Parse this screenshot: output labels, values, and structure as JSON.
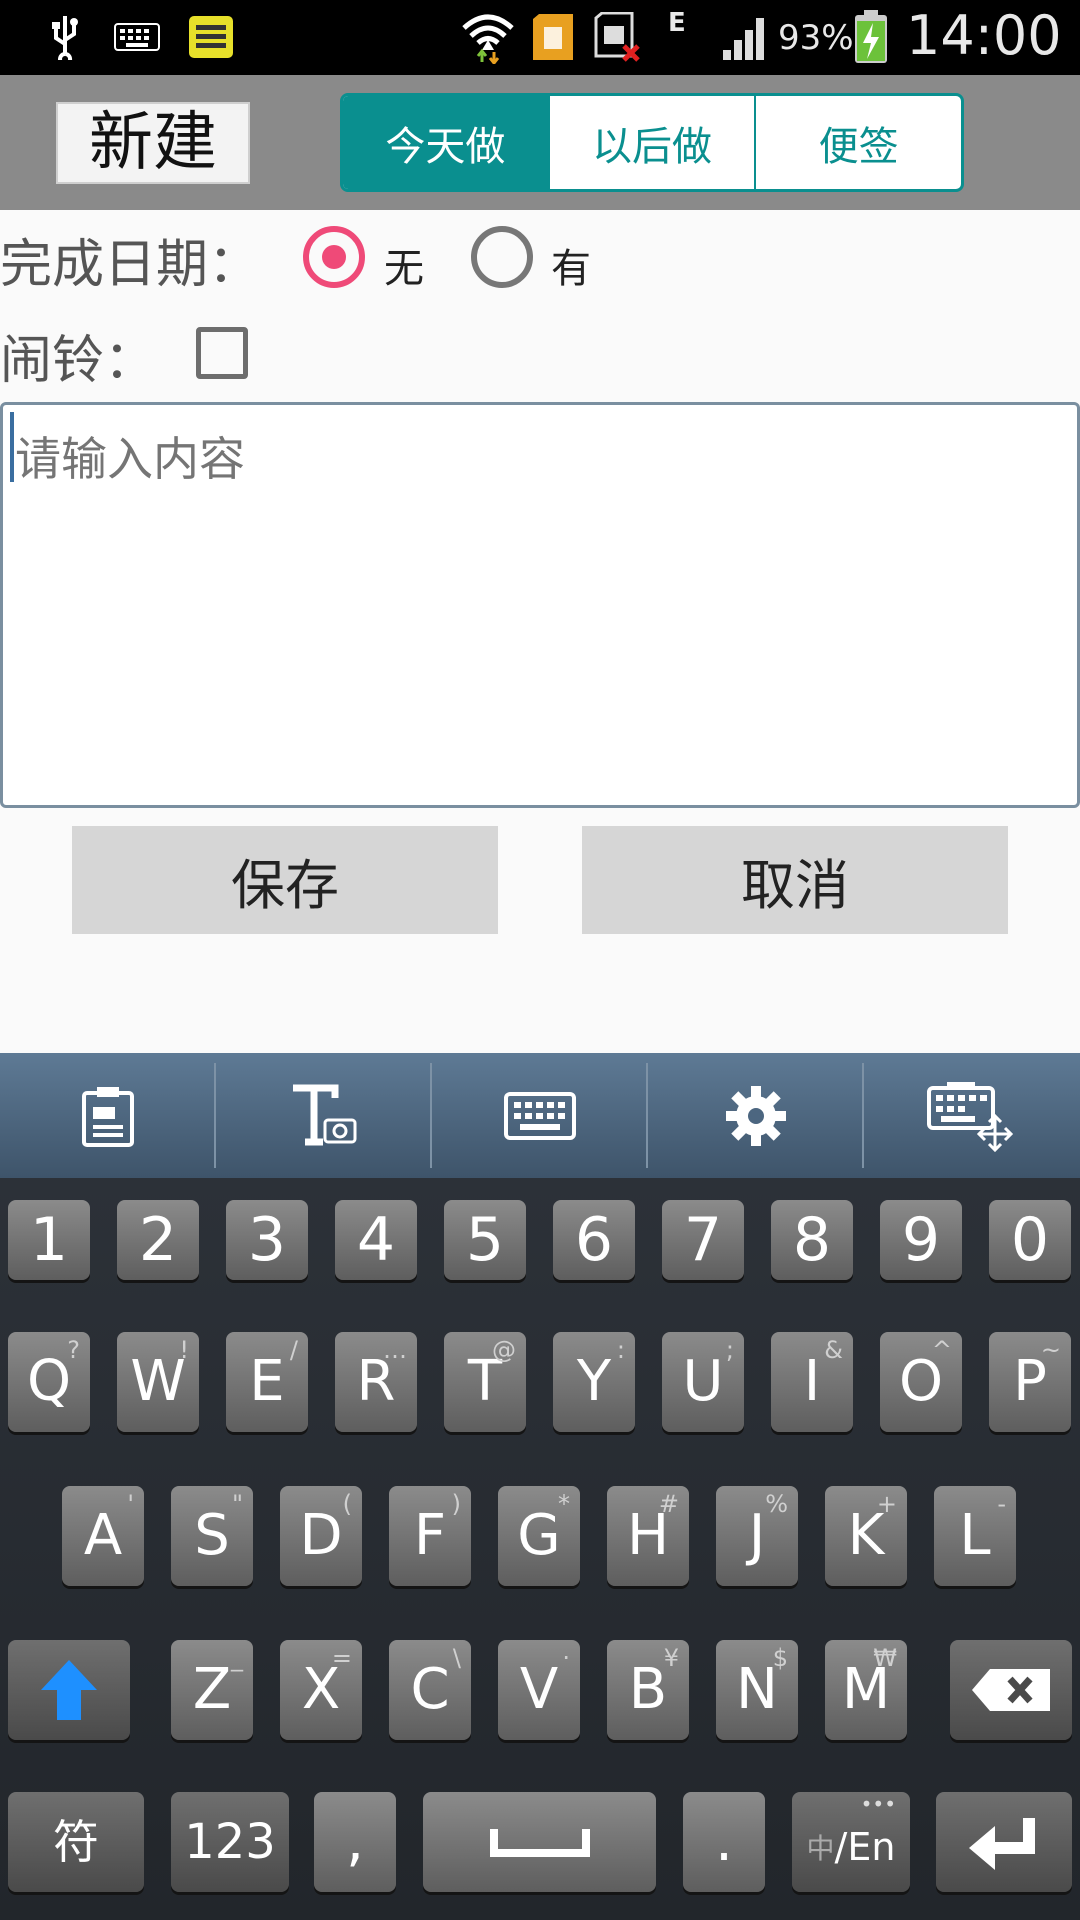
{
  "status_bar": {
    "battery": "93%",
    "time": "14:00",
    "network": "E",
    "icons": [
      "usb-icon",
      "keyboard-icon",
      "notes-app-icon",
      "wifi-icon",
      "sim-card-icon",
      "sd-card-error-icon",
      "signal-icon",
      "battery-charging-icon"
    ]
  },
  "header": {
    "new_label": "新建",
    "tabs": [
      {
        "label": "今天做",
        "active": true
      },
      {
        "label": "以后做",
        "active": false
      },
      {
        "label": "便签",
        "active": false
      }
    ]
  },
  "form": {
    "due_date_label": "完成日期：",
    "due_none": "无",
    "due_has": "有",
    "due_selected": "无",
    "alarm_label": "闹铃：",
    "alarm_checked": false,
    "content_placeholder": "请输入内容",
    "content_value": "",
    "save_label": "保存",
    "cancel_label": "取消"
  },
  "keyboard": {
    "toolbar": [
      "clipboard-icon",
      "handwriting-text-icon",
      "keyboard-icon",
      "settings-gear-icon",
      "keyboard-move-icon"
    ],
    "row_numbers": [
      "1",
      "2",
      "3",
      "4",
      "5",
      "6",
      "7",
      "8",
      "9",
      "0"
    ],
    "row1": [
      {
        "key": "Q",
        "sub": "?"
      },
      {
        "key": "W",
        "sub": "!"
      },
      {
        "key": "E",
        "sub": "/"
      },
      {
        "key": "R",
        "sub": "…"
      },
      {
        "key": "T",
        "sub": "@"
      },
      {
        "key": "Y",
        "sub": ":"
      },
      {
        "key": "U",
        "sub": ";"
      },
      {
        "key": "I",
        "sub": "&"
      },
      {
        "key": "O",
        "sub": "^"
      },
      {
        "key": "P",
        "sub": "~"
      }
    ],
    "row2": [
      {
        "key": "A",
        "sub": "'"
      },
      {
        "key": "S",
        "sub": "\""
      },
      {
        "key": "D",
        "sub": "("
      },
      {
        "key": "F",
        "sub": ")"
      },
      {
        "key": "G",
        "sub": "*"
      },
      {
        "key": "H",
        "sub": "#"
      },
      {
        "key": "J",
        "sub": "%"
      },
      {
        "key": "K",
        "sub": "+"
      },
      {
        "key": "L",
        "sub": "-"
      }
    ],
    "row3": [
      {
        "key": "Z",
        "sub": "_"
      },
      {
        "key": "X",
        "sub": "="
      },
      {
        "key": "C",
        "sub": "\\"
      },
      {
        "key": "V",
        "sub": "·"
      },
      {
        "key": "B",
        "sub": "¥"
      },
      {
        "key": "N",
        "sub": "$"
      },
      {
        "key": "M",
        "sub": "₩"
      }
    ],
    "symbol_key": "符",
    "num_key": "123",
    "comma_key": ",",
    "period_key": ".",
    "lang_key_zh": "中",
    "lang_key_en": "/En",
    "lang_key_dots": "•••"
  },
  "colors": {
    "accent": "#0a8f8f",
    "radio": "#ef4a78",
    "shift": "#1e90ff"
  }
}
